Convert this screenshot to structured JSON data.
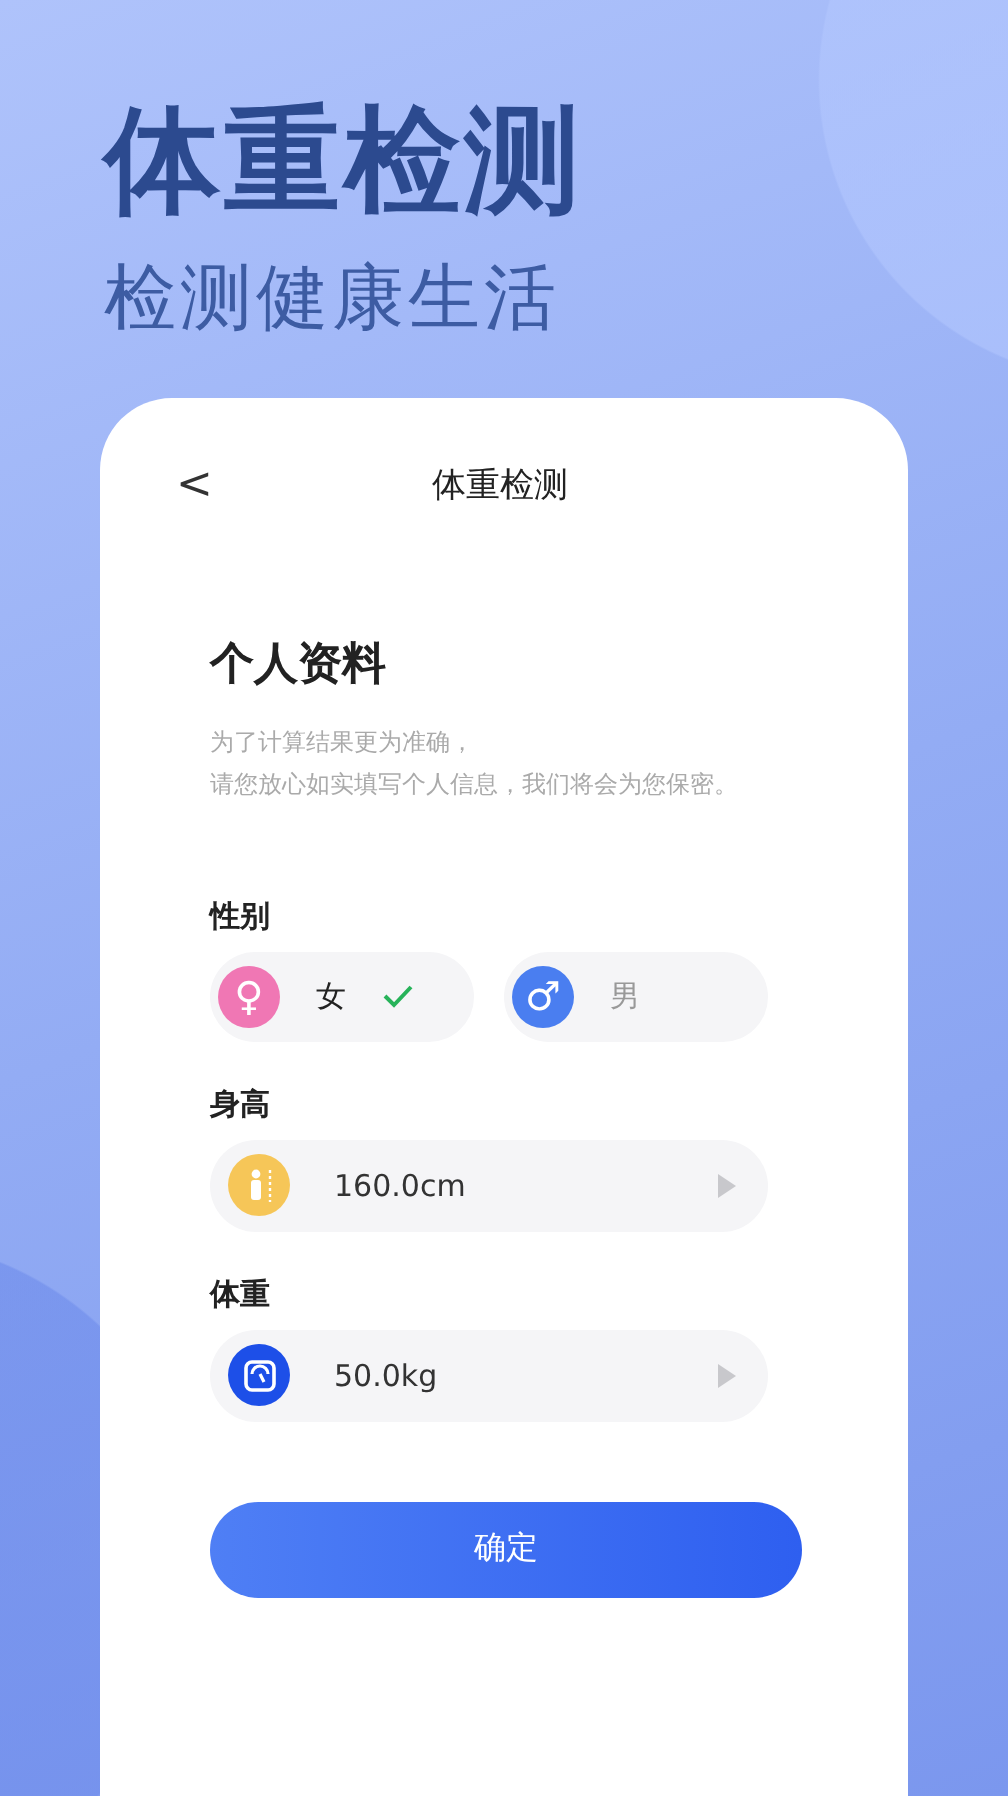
{
  "hero": {
    "title": "体重检测",
    "subtitle": "检测健康生活"
  },
  "screen": {
    "back": "<",
    "title": "体重检测"
  },
  "profile": {
    "heading": "个人资料",
    "description": [
      "为了计算结果更为准确，",
      "请您放心如实填写个人信息，我们将会为您保密。"
    ]
  },
  "gender": {
    "label": "性别",
    "options": [
      {
        "kind": "female",
        "symbol": "♀",
        "label": "女",
        "selected": true
      },
      {
        "kind": "male",
        "symbol": "♂",
        "label": "男",
        "selected": false
      }
    ]
  },
  "fields": [
    {
      "kind": "height",
      "label": "身高",
      "value": "160.0cm"
    },
    {
      "kind": "weight",
      "label": "体重",
      "value": "50.0kg"
    }
  ],
  "confirm_button": "确定"
}
